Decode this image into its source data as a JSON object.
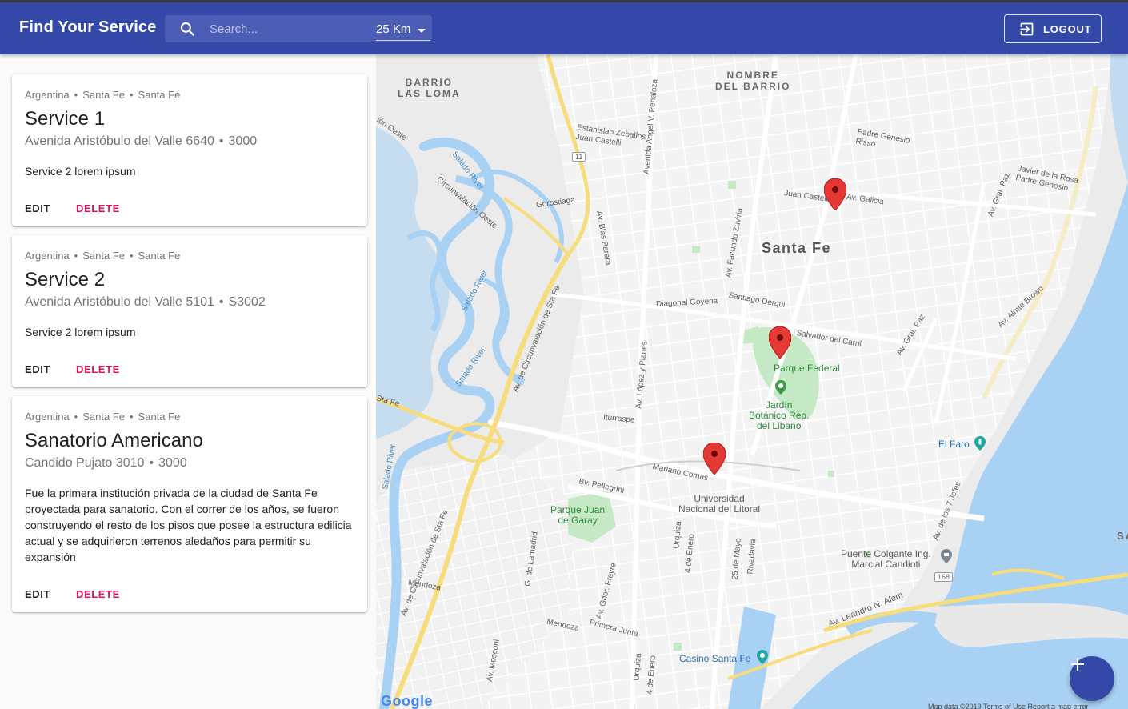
{
  "appbar": {
    "title": "Find Your Service",
    "search_placeholder": "Search...",
    "search_value": "",
    "radius": "25 Km",
    "logout_label": "LOGOUT"
  },
  "services": [
    {
      "country": "Argentina",
      "province": "Santa Fe",
      "city": "Santa Fe",
      "name": "Service 1",
      "street": "Avenida Aristóbulo del Valle 6640",
      "postal": "3000",
      "description": "Service 2 lorem ipsum",
      "edit_label": "EDIT",
      "delete_label": "DELETE"
    },
    {
      "country": "Argentina",
      "province": "Santa Fe",
      "city": "Santa Fe",
      "name": "Service 2",
      "street": "Avenida Aristóbulo del Valle 5101",
      "postal": "S3002",
      "description": "Service 2 lorem ipsum",
      "edit_label": "EDIT",
      "delete_label": "DELETE"
    },
    {
      "country": "Argentina",
      "province": "Santa Fe",
      "city": "Santa Fe",
      "name": "Sanatorio Americano",
      "street": "Candido Pujato 3010",
      "postal": "3000",
      "description": "Fue la primera institución privada de la ciudad de Santa Fe proyectada para sanatorio. Con el correr de los años, se fueron construyendo el resto de los pisos que posee la estructura edilicia actual y se adquirieron terrenos aledaños para permitir su expansión",
      "edit_label": "EDIT",
      "delete_label": "DELETE"
    }
  ],
  "map": {
    "labels": {
      "barrio_las_loma": "BARRIO\nLAS LOMA",
      "nombre_del_barrio": "NOMBRE\nDEL BARRIO",
      "santa_fe": "Santa Fe",
      "parque_federal": "Parque Federal",
      "jardin_botanico": "Jardín\nBotánico Rep.\ndel Libano",
      "el_faro": "El Faro",
      "parque_juan_de_garay": "Parque Juan\nde Garay",
      "universidad": "Universidad\nNacional del Litoral",
      "puente_colgante": "Puente Colgante Ing.\nMarcial Candioti",
      "casino": "Casino Santa Fe",
      "salado_river": "Salado River",
      "circunvalacion_oeste": "Circunvalación Oeste",
      "av_circunvalacion": "Av. de Circunvalación de Sta Fe",
      "gorostiaga": "Gorostiaga",
      "av_blas_parera": "Av. Blas Parera",
      "av_facundo_zuviria": "Av. Facundo Zuviria",
      "juan_castelli": "Juan Castelli",
      "av_galicia": "Av. Galicia",
      "padre_genesio": "Padre Genesio\nRisso",
      "javier_de_la_rosa": "Javier de la Rosa\nPadre Genesio",
      "av_gral_paz": "Av. Gral. Paz",
      "diagonal_goyena": "Diagonal Goyena",
      "santiago_derqui": "Santiago Derqui",
      "salvador_del_carril": "Salvador del Carril",
      "av_almte_brown": "Av. Almte Brown",
      "av_lopez_y_planes": "Av. López y Planes",
      "iturraspe": "Iturraspe",
      "mariano_comas": "Mariano Comas",
      "bv_pellegrini": "Bv. Pellegrini",
      "mendoza": "Mendoza",
      "primera_junta": "Primera Junta",
      "av_leandro_n_alem": "Av. Leandro N. Alem",
      "av_de_los_7_jefes": "Av. de los 7 Jefes",
      "estanislao_zeballos": "Estanislao Zeballos\nJuan Castelli",
      "av_angel_penaloza": "Avenida Angel V. Peñaloza",
      "ion_oeste": "ión Oeste",
      "sta_fe_route": "Sta Fe",
      "route_11": "11",
      "route_168": "168",
      "urquiza": "Urquiza",
      "cuatro_de_enero": "4 de Enero",
      "veinticinco_de_mayo": "25 de Mayo",
      "rivadavia": "Rivadavia",
      "g_de_lamadrid": "G. de Lamadrid",
      "av_gdor_freyre": "Av. Gdor. Freyre",
      "av_mosconi": "Av. Mosconi",
      "san_cut": "SAN"
    },
    "footer": "Map data ©2019   Terms of Use   Report a map error",
    "google_logo": "Google",
    "markers": 3
  },
  "colors": {
    "primary": "#3448a8",
    "accent": "#e0115f",
    "water": "#a8d1f4",
    "park": "#c5e8c5",
    "marker": "#e53935",
    "highway": "#f7dc7c"
  }
}
